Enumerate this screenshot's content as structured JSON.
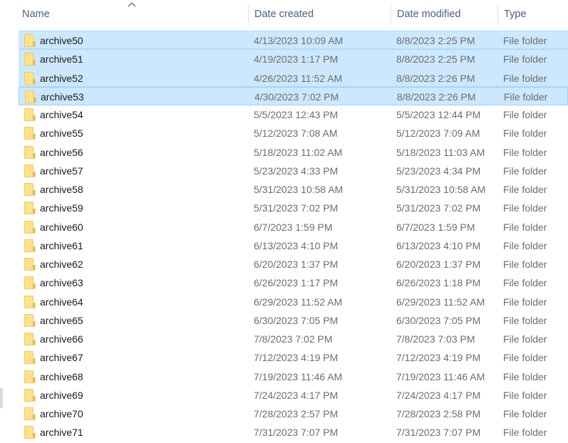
{
  "header": {
    "columns": [
      {
        "key": "name",
        "label": "Name"
      },
      {
        "key": "created",
        "label": "Date created"
      },
      {
        "key": "modified",
        "label": "Date modified"
      },
      {
        "key": "type",
        "label": "Type"
      }
    ],
    "sort_column": "name",
    "sort_direction": "ascending",
    "sort_icon": "chevron-up-icon"
  },
  "colors": {
    "selection_bg": "#cce8ff",
    "selection_border": "#99d1ff",
    "folder_fill": "#ffe28a",
    "folder_edge": "#e8b94a",
    "header_text": "#4c607a",
    "detail_text": "#6d6d6d"
  },
  "files": [
    {
      "name": "archive50",
      "created": "4/13/2023 10:09 AM",
      "modified": "8/8/2023 2:25 PM",
      "type": "File folder",
      "selected": true,
      "focused": false,
      "icon": "folder-icon"
    },
    {
      "name": "archive51",
      "created": "4/19/2023 1:17 PM",
      "modified": "8/8/2023 2:25 PM",
      "type": "File folder",
      "selected": true,
      "focused": false,
      "icon": "folder-icon"
    },
    {
      "name": "archive52",
      "created": "4/26/2023 11:52 AM",
      "modified": "8/8/2023 2:26 PM",
      "type": "File folder",
      "selected": true,
      "focused": false,
      "icon": "folder-icon"
    },
    {
      "name": "archive53",
      "created": "4/30/2023 7:02 PM",
      "modified": "8/8/2023 2:26 PM",
      "type": "File folder",
      "selected": true,
      "focused": true,
      "icon": "folder-icon"
    },
    {
      "name": "archive54",
      "created": "5/5/2023 12:43 PM",
      "modified": "5/5/2023 12:44 PM",
      "type": "File folder",
      "selected": false,
      "focused": false,
      "icon": "folder-icon"
    },
    {
      "name": "archive55",
      "created": "5/12/2023 7:08 AM",
      "modified": "5/12/2023 7:09 AM",
      "type": "File folder",
      "selected": false,
      "focused": false,
      "icon": "folder-icon"
    },
    {
      "name": "archive56",
      "created": "5/18/2023 11:02 AM",
      "modified": "5/18/2023 11:03 AM",
      "type": "File folder",
      "selected": false,
      "focused": false,
      "icon": "folder-icon"
    },
    {
      "name": "archive57",
      "created": "5/23/2023 4:33 PM",
      "modified": "5/23/2023 4:34 PM",
      "type": "File folder",
      "selected": false,
      "focused": false,
      "icon": "folder-icon"
    },
    {
      "name": "archive58",
      "created": "5/31/2023 10:58 AM",
      "modified": "5/31/2023 10:58 AM",
      "type": "File folder",
      "selected": false,
      "focused": false,
      "icon": "folder-icon"
    },
    {
      "name": "archive59",
      "created": "5/31/2023 7:02 PM",
      "modified": "5/31/2023 7:02 PM",
      "type": "File folder",
      "selected": false,
      "focused": false,
      "icon": "folder-icon"
    },
    {
      "name": "archive60",
      "created": "6/7/2023 1:59 PM",
      "modified": "6/7/2023 1:59 PM",
      "type": "File folder",
      "selected": false,
      "focused": false,
      "icon": "folder-icon"
    },
    {
      "name": "archive61",
      "created": "6/13/2023 4:10 PM",
      "modified": "6/13/2023 4:10 PM",
      "type": "File folder",
      "selected": false,
      "focused": false,
      "icon": "folder-icon"
    },
    {
      "name": "archive62",
      "created": "6/20/2023 1:37 PM",
      "modified": "6/20/2023 1:37 PM",
      "type": "File folder",
      "selected": false,
      "focused": false,
      "icon": "folder-icon"
    },
    {
      "name": "archive63",
      "created": "6/26/2023 1:17 PM",
      "modified": "6/26/2023 1:18 PM",
      "type": "File folder",
      "selected": false,
      "focused": false,
      "icon": "folder-icon"
    },
    {
      "name": "archive64",
      "created": "6/29/2023 11:52 AM",
      "modified": "6/29/2023 11:52 AM",
      "type": "File folder",
      "selected": false,
      "focused": false,
      "icon": "folder-icon"
    },
    {
      "name": "archive65",
      "created": "6/30/2023 7:05 PM",
      "modified": "6/30/2023 7:05 PM",
      "type": "File folder",
      "selected": false,
      "focused": false,
      "icon": "folder-icon"
    },
    {
      "name": "archive66",
      "created": "7/8/2023 7:02 PM",
      "modified": "7/8/2023 7:03 PM",
      "type": "File folder",
      "selected": false,
      "focused": false,
      "icon": "folder-icon"
    },
    {
      "name": "archive67",
      "created": "7/12/2023 4:19 PM",
      "modified": "7/12/2023 4:19 PM",
      "type": "File folder",
      "selected": false,
      "focused": false,
      "icon": "folder-icon"
    },
    {
      "name": "archive68",
      "created": "7/19/2023 11:46 AM",
      "modified": "7/19/2023 11:46 AM",
      "type": "File folder",
      "selected": false,
      "focused": false,
      "icon": "folder-icon"
    },
    {
      "name": "archive69",
      "created": "7/24/2023 4:17 PM",
      "modified": "7/24/2023 4:17 PM",
      "type": "File folder",
      "selected": false,
      "focused": false,
      "icon": "folder-icon"
    },
    {
      "name": "archive70",
      "created": "7/28/2023 2:57 PM",
      "modified": "7/28/2023 2:58 PM",
      "type": "File folder",
      "selected": false,
      "focused": false,
      "icon": "folder-icon"
    },
    {
      "name": "archive71",
      "created": "7/31/2023 7:07 PM",
      "modified": "7/31/2023 7:07 PM",
      "type": "File folder",
      "selected": false,
      "focused": false,
      "icon": "folder-icon"
    }
  ]
}
